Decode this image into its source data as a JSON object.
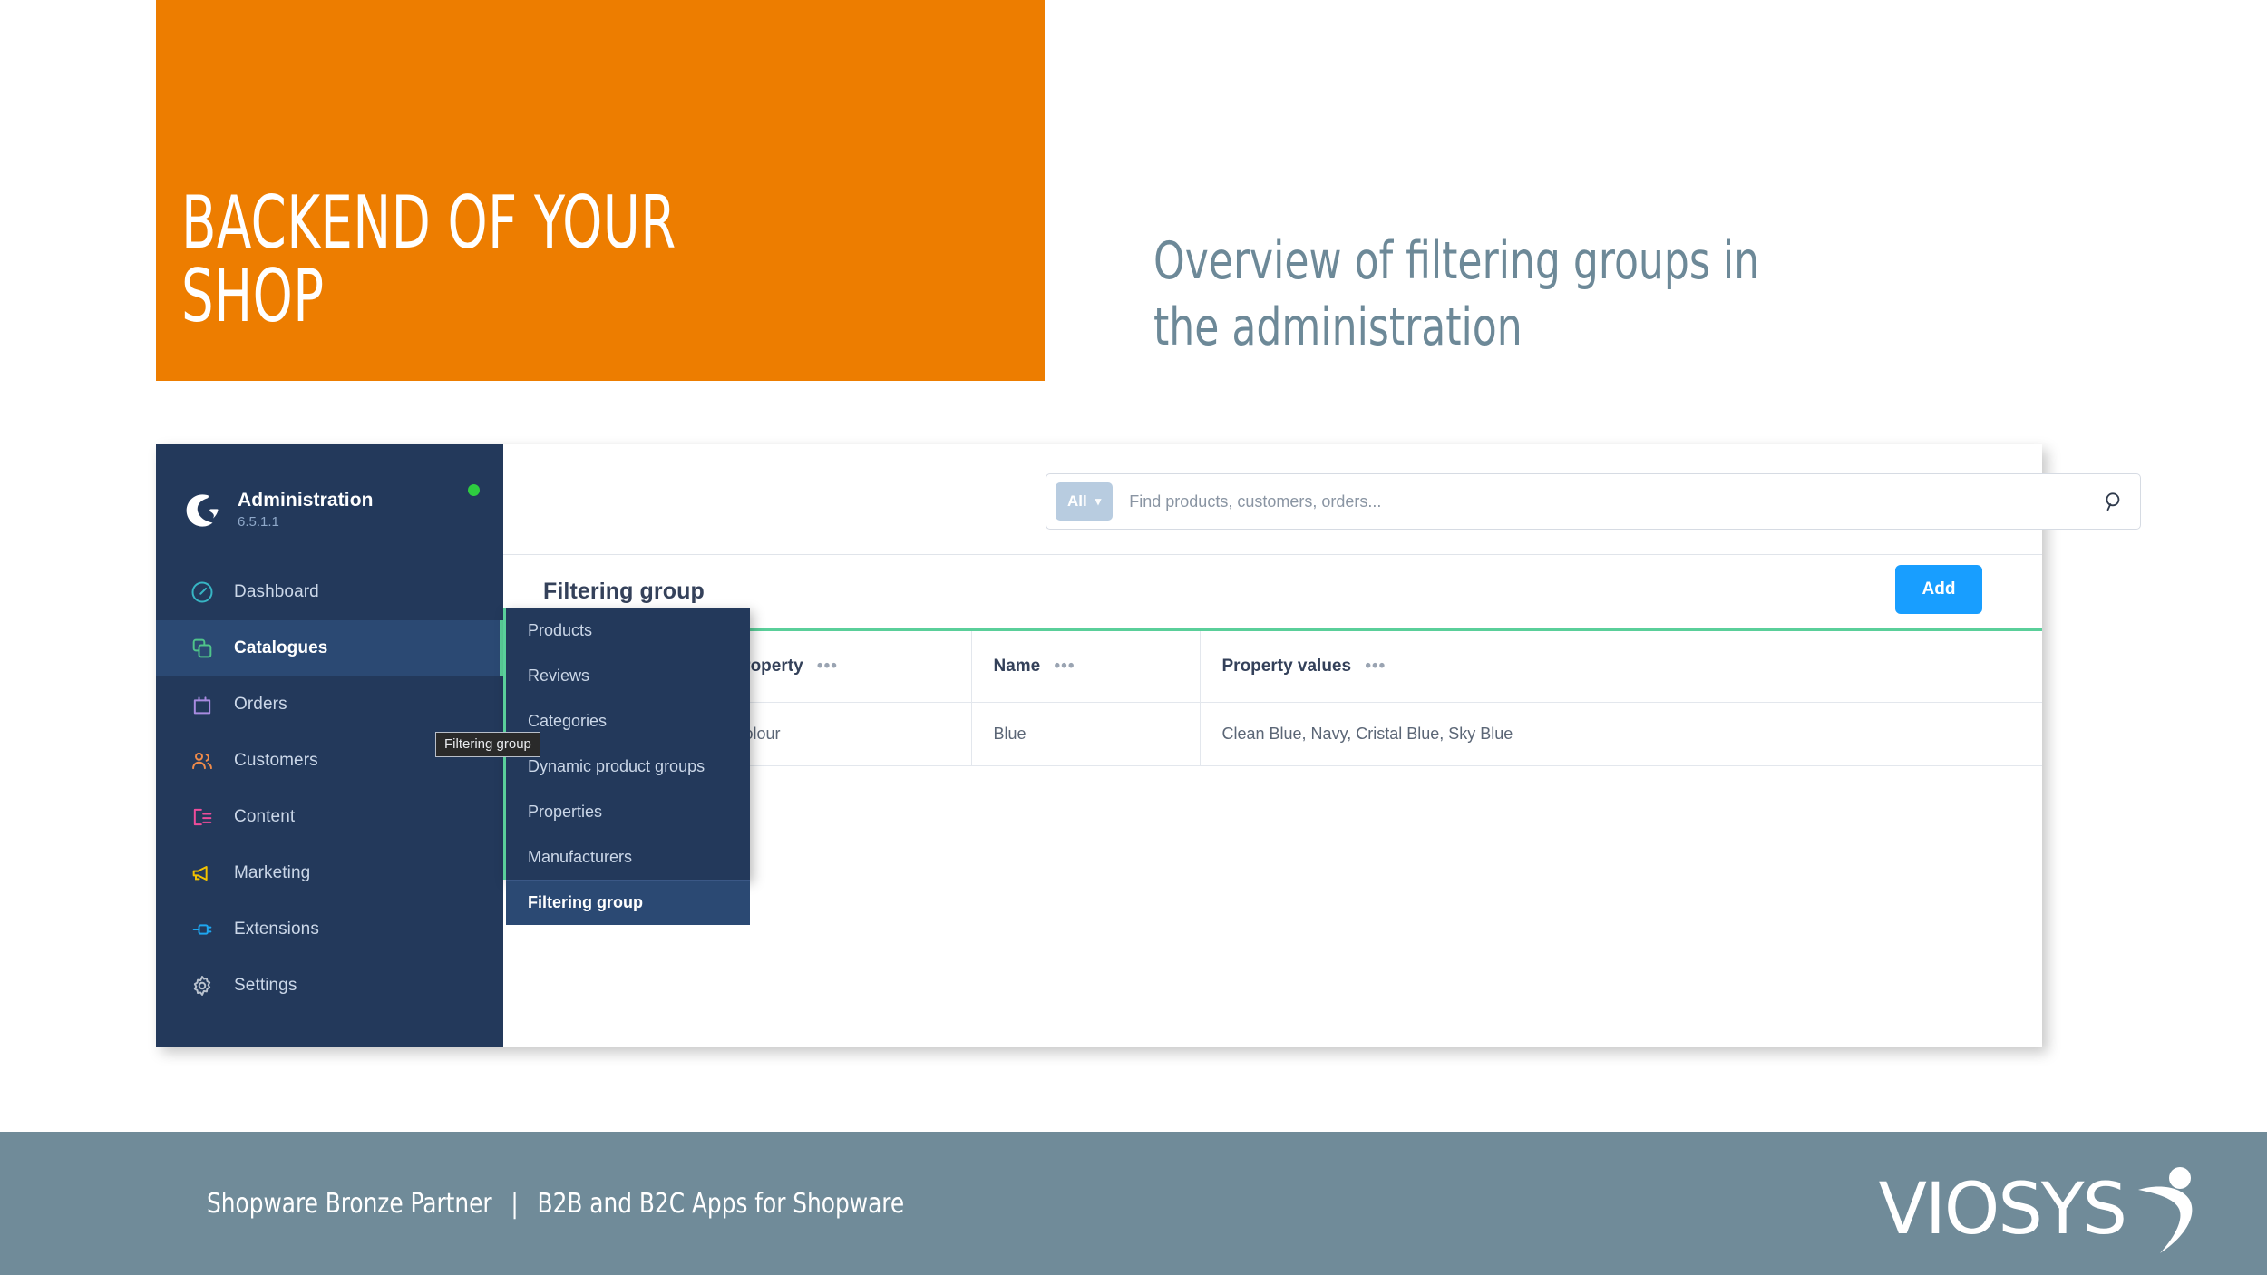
{
  "slide": {
    "title_block": {
      "headline": "BACKEND OF YOUR\nSHOP",
      "background_color": "#ED7D00"
    },
    "subheadline": "Overview of filtering groups in\nthe administration",
    "subheadline_color": "#6D8998"
  },
  "admin": {
    "sidebar": {
      "app_name": "Administration",
      "version": "6.5.1.1",
      "logo_icon": "shopware-logo-icon",
      "status_dot_color": "#2ECC40",
      "background_color": "#23395B",
      "active_color": "#2B4973",
      "accent_color": "#5ACF9A",
      "items": [
        {
          "label": "Dashboard",
          "icon": "dashboard-icon",
          "color": "#37B5C4",
          "active": false
        },
        {
          "label": "Catalogues",
          "icon": "catalogues-icon",
          "color": "#4FC48A",
          "active": true
        },
        {
          "label": "Orders",
          "icon": "orders-icon",
          "color": "#A88BE0",
          "active": false
        },
        {
          "label": "Customers",
          "icon": "customers-icon",
          "color": "#F08B4A",
          "active": false
        },
        {
          "label": "Content",
          "icon": "content-icon",
          "color": "#EE4C9B",
          "active": false
        },
        {
          "label": "Marketing",
          "icon": "marketing-icon",
          "color": "#F2C200",
          "active": false
        },
        {
          "label": "Extensions",
          "icon": "extensions-icon",
          "color": "#1EA6F0",
          "active": false
        },
        {
          "label": "Settings",
          "icon": "settings-icon",
          "color": "#B9C2CE",
          "active": false
        }
      ]
    },
    "submenu": {
      "items": [
        {
          "label": "Products",
          "active": false
        },
        {
          "label": "Reviews",
          "active": false
        },
        {
          "label": "Categories",
          "active": false
        },
        {
          "label": "Dynamic product groups",
          "active": false
        },
        {
          "label": "Properties",
          "active": false
        },
        {
          "label": "Manufacturers",
          "active": false
        },
        {
          "label": "Filtering group",
          "active": true
        }
      ]
    },
    "tooltip": "Filtering group",
    "search": {
      "scope_label": "All",
      "chevron": "⌄",
      "placeholder": "Find products, customers, orders...",
      "value": "",
      "icon": "search-icon"
    },
    "page": {
      "title": "Filtering group",
      "add_label": "Add",
      "add_color": "#189EFF",
      "accent_line_color": "#5ACF9A"
    },
    "table": {
      "columns": [
        "",
        "Property",
        "Name",
        "Property values"
      ],
      "menu_glyph": "•••",
      "rows": [
        {
          "select": "",
          "property": "Colour",
          "name": "Blue",
          "values": "Clean Blue, Navy, Cristal Blue, Sky Blue"
        }
      ]
    }
  },
  "footer": {
    "background_color": "#708B99",
    "text_left": "Shopware Bronze Partner",
    "separator": "|",
    "text_right": "B2B and B2C Apps for Shopware",
    "brand": "VIOSYS",
    "brand_mark": "viosys-swoosh-icon"
  }
}
